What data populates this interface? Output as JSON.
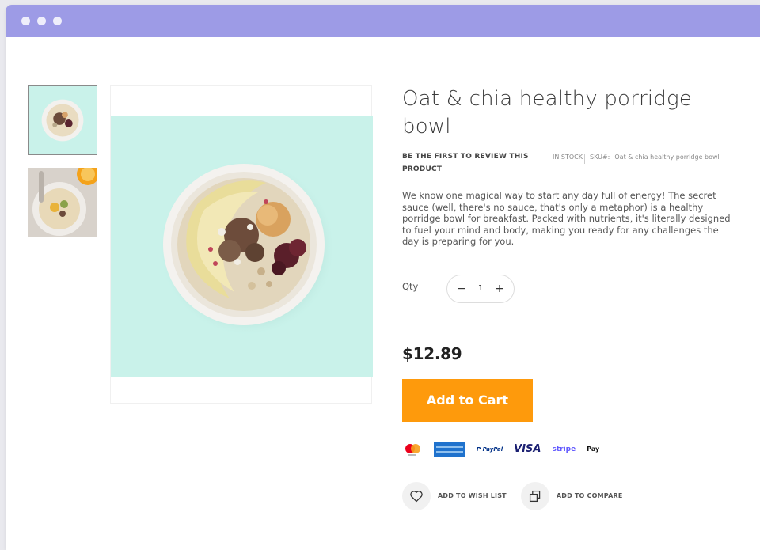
{
  "product": {
    "title": "Oat & chia healthy porridge bowl",
    "review_link": "BE THE FIRST TO REVIEW THIS PRODUCT",
    "stock": "IN STOCK",
    "sku_label": "SKU#:",
    "sku_value": "Oat & chia healthy porridge bowl",
    "description": "We know one magical way to start any day full of energy! The secret sauce (well, there's no sauce, that's only a metaphor) is a healthy porridge bowl for breakfast. Packed with nutrients, it's literally designed to fuel your mind and body, making you ready for any challenges the day is preparing for you.",
    "price": "$12.89"
  },
  "quantity": {
    "label": "Qty",
    "value": "1",
    "decrement": "−",
    "increment": "+"
  },
  "cart": {
    "add_label": "Add to Cart"
  },
  "payments": {
    "paypal": "P PayPal",
    "visa": "VISA",
    "stripe": "stripe",
    "applepay": " Pay"
  },
  "actions": {
    "wishlist_label": "ADD TO WISH LIST",
    "compare_label": "ADD TO COMPARE"
  },
  "colors": {
    "titlebar": "#9d9be6",
    "accent": "#fe9a0c",
    "image_bg": "#c9f2ea"
  },
  "icons": {
    "wishlist": "heart-icon",
    "compare": "compare-icon"
  }
}
